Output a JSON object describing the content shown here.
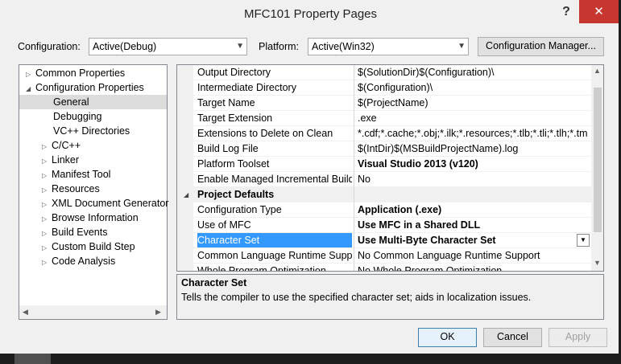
{
  "window": {
    "title": "MFC101 Property Pages",
    "help": "?",
    "close": "✕"
  },
  "config_bar": {
    "configuration_label": "Configuration:",
    "configuration_value": "Active(Debug)",
    "platform_label": "Platform:",
    "platform_value": "Active(Win32)",
    "manager_button": "Configuration Manager..."
  },
  "tree": {
    "items": [
      {
        "label": "Common Properties",
        "expander": "▷"
      },
      {
        "label": "Configuration Properties",
        "expander": "◢"
      },
      {
        "label": "General",
        "expander": ""
      },
      {
        "label": "Debugging",
        "expander": ""
      },
      {
        "label": "VC++ Directories",
        "expander": ""
      },
      {
        "label": "C/C++",
        "expander": "▷"
      },
      {
        "label": "Linker",
        "expander": "▷"
      },
      {
        "label": "Manifest Tool",
        "expander": "▷"
      },
      {
        "label": "Resources",
        "expander": "▷"
      },
      {
        "label": "XML Document Generator",
        "expander": "▷"
      },
      {
        "label": "Browse Information",
        "expander": "▷"
      },
      {
        "label": "Build Events",
        "expander": "▷"
      },
      {
        "label": "Custom Build Step",
        "expander": "▷"
      },
      {
        "label": "Code Analysis",
        "expander": "▷"
      }
    ]
  },
  "grid": {
    "rows": [
      {
        "name": "Output Directory",
        "value": "$(SolutionDir)$(Configuration)\\"
      },
      {
        "name": "Intermediate Directory",
        "value": "$(Configuration)\\"
      },
      {
        "name": "Target Name",
        "value": "$(ProjectName)"
      },
      {
        "name": "Target Extension",
        "value": ".exe"
      },
      {
        "name": "Extensions to Delete on Clean",
        "value": "*.cdf;*.cache;*.obj;*.ilk;*.resources;*.tlb;*.tli;*.tlh;*.tmp;*"
      },
      {
        "name": "Build Log File",
        "value": "$(IntDir)$(MSBuildProjectName).log"
      },
      {
        "name": "Platform Toolset",
        "value": "Visual Studio 2013 (v120)"
      },
      {
        "name": "Enable Managed Incremental Build",
        "value": "No"
      }
    ],
    "category": {
      "name": "Project Defaults",
      "expander": "◢"
    },
    "defaults_rows": [
      {
        "name": "Configuration Type",
        "value": "Application (.exe)"
      },
      {
        "name": "Use of MFC",
        "value": "Use MFC in a Shared DLL"
      },
      {
        "name": "Character Set",
        "value": "Use Multi-Byte Character Set"
      },
      {
        "name": "Common Language Runtime Support",
        "value": "No Common Language Runtime Support"
      },
      {
        "name": "Whole Program Optimization",
        "value": "No Whole Program Optimization"
      }
    ],
    "dropdown_glyph": "▼"
  },
  "description": {
    "title": "Character Set",
    "text": "Tells the compiler to use the specified character set; aids in localization issues."
  },
  "buttons": {
    "ok": "OK",
    "cancel": "Cancel",
    "apply": "Apply"
  },
  "scroll_glyphs": {
    "up": "▲",
    "down": "▼",
    "left": "◀",
    "right": "▶"
  }
}
